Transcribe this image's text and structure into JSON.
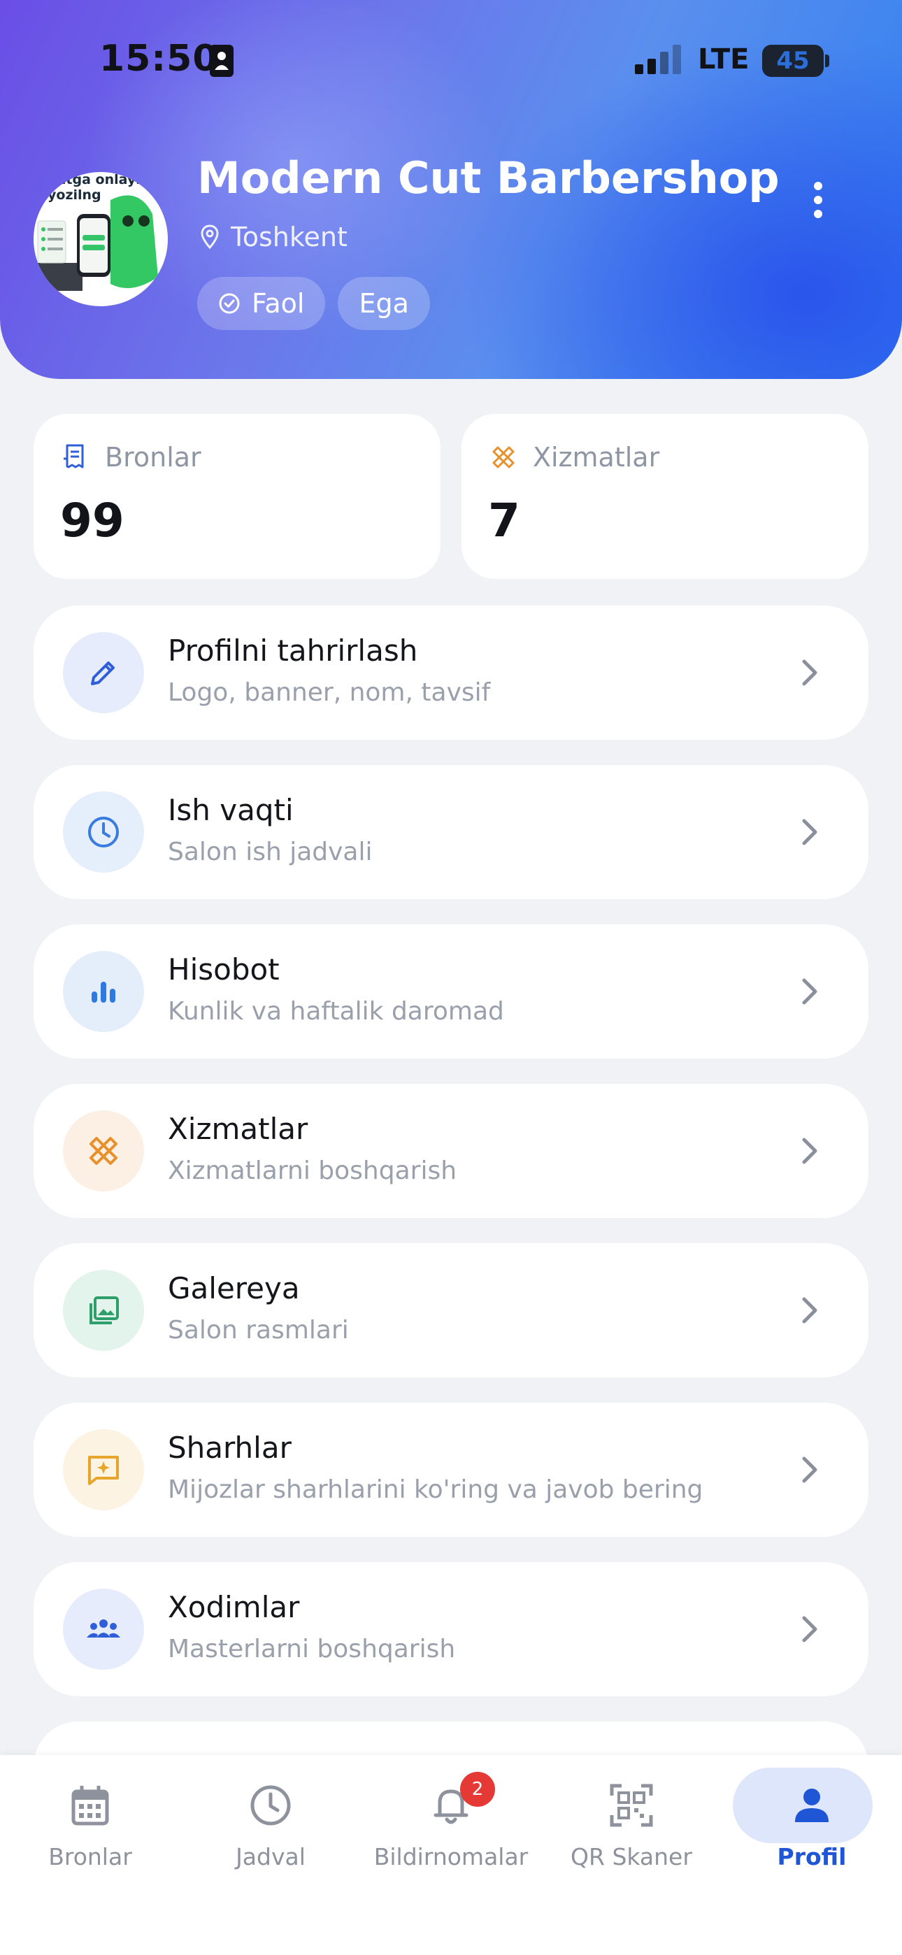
{
  "status_bar": {
    "time": "15:50",
    "network": "LTE",
    "battery": "45"
  },
  "header": {
    "avatar_text": "batga onlayn yozilng",
    "business_name": "Modern Cut Barbershop",
    "location": "Toshkent",
    "chips": [
      {
        "label": "Faol",
        "icon": "check-circle-icon"
      },
      {
        "label": "Ega"
      }
    ]
  },
  "stats": [
    {
      "label": "Bronlar",
      "value": "99",
      "icon": "receipt-icon",
      "color": "#2f5fd8"
    },
    {
      "label": "Xizmatlar",
      "value": "7",
      "icon": "scissors-icon",
      "color": "#e8912c"
    }
  ],
  "menu": [
    {
      "title": "Profilni tahrirlash",
      "subtitle": "Logo, banner, nom, tavsif",
      "icon": "pencil-icon",
      "color": "#2f5fd8",
      "bg": "#e6ecfb"
    },
    {
      "title": "Ish vaqti",
      "subtitle": "Salon ish jadvali",
      "icon": "clock-icon",
      "color": "#3a7be0",
      "bg": "#e5eefb"
    },
    {
      "title": "Hisobot",
      "subtitle": "Kunlik va haftalik daromad",
      "icon": "bar-chart-icon",
      "color": "#2f7ae0",
      "bg": "#e4eefb"
    },
    {
      "title": "Xizmatlar",
      "subtitle": "Xizmatlarni boshqarish",
      "icon": "scissors-icon",
      "color": "#e8912c",
      "bg": "#fcefe4"
    },
    {
      "title": "Galereya",
      "subtitle": "Salon rasmlari",
      "icon": "gallery-icon",
      "color": "#2e9e6a",
      "bg": "#e3f4ec"
    },
    {
      "title": "Sharhlar",
      "subtitle": "Mijozlar sharhlarini ko'ring va javob bering",
      "icon": "review-icon",
      "color": "#e8a52c",
      "bg": "#fdf3e3"
    },
    {
      "title": "Xodimlar",
      "subtitle": "Masterlarni boshqarish",
      "icon": "team-icon",
      "color": "#2f5fd8",
      "bg": "#e6ecfb"
    }
  ],
  "bottom_nav": [
    {
      "label": "Bronlar",
      "icon": "calendar-icon",
      "active": false
    },
    {
      "label": "Jadval",
      "icon": "clock-icon",
      "active": false
    },
    {
      "label": "Bildirnomalar",
      "icon": "bell-icon",
      "active": false,
      "badge": "2"
    },
    {
      "label": "QR Skaner",
      "icon": "qr-icon",
      "active": false
    },
    {
      "label": "Profil",
      "icon": "person-icon",
      "active": true
    }
  ],
  "colors": {
    "accent": "#1f56d6",
    "badge": "#e53935"
  }
}
